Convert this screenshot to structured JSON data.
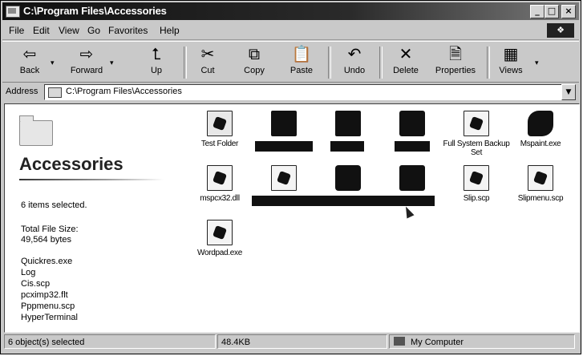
{
  "window": {
    "title": "C:\\Program Files\\Accessories",
    "controls": {
      "minimize": "_",
      "maximize": "□",
      "close": "×"
    }
  },
  "menu": [
    "File",
    "Edit",
    "View",
    "Go",
    "Favorites",
    "Help"
  ],
  "toolbar": {
    "back": "Back",
    "forward": "Forward",
    "up": "Up",
    "cut": "Cut",
    "copy": "Copy",
    "paste": "Paste",
    "undo": "Undo",
    "delete": "Delete",
    "properties": "Properties",
    "views": "Views"
  },
  "address": {
    "label": "Address",
    "value": "C:\\Program Files\\Accessories"
  },
  "left_pane": {
    "title": "Accessories",
    "selected": "6 items selected.",
    "size_label": "Total File Size:",
    "size_value": "49,564 bytes",
    "selected_files": [
      "Quickres.exe",
      "Log",
      "Cis.scp",
      "pcximp32.flt",
      "Pppmenu.scp",
      "HyperTerminal"
    ]
  },
  "files": [
    {
      "name": "Test Folder",
      "selected": false,
      "icon": "folder-icon"
    },
    {
      "name": "",
      "selected": true,
      "icon": "folder-icon"
    },
    {
      "name": "",
      "selected": true,
      "icon": "folder-icon"
    },
    {
      "name": "",
      "selected": true,
      "icon": "calculator-icon"
    },
    {
      "name": "Full System Backup Set",
      "selected": false,
      "icon": "backup-icon"
    },
    {
      "name": "Mspaint.exe",
      "selected": false,
      "icon": "paint-icon"
    },
    {
      "name": "mspcx32.dll",
      "selected": false,
      "icon": "dll-icon"
    },
    {
      "name": "",
      "selected": true,
      "icon": "document-icon"
    },
    {
      "name": "",
      "selected": true,
      "icon": "document-icon"
    },
    {
      "name": "",
      "selected": true,
      "icon": "terminal-icon"
    },
    {
      "name": "Slip.scp",
      "selected": false,
      "icon": "script-icon"
    },
    {
      "name": "Slipmenu.scp",
      "selected": false,
      "icon": "script-icon"
    },
    {
      "name": "Wordpad.exe",
      "selected": false,
      "icon": "wordpad-icon"
    }
  ],
  "status": {
    "objects": "6 object(s) selected",
    "size": "48.4KB",
    "zone": "My Computer"
  }
}
